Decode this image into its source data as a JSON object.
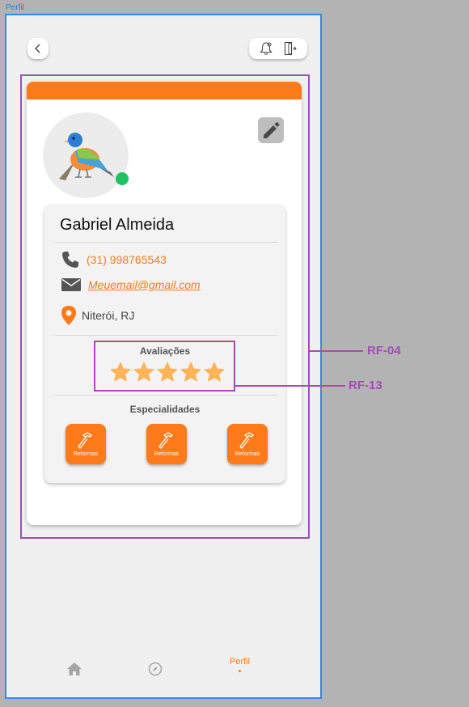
{
  "frame": {
    "label": "Perfil"
  },
  "profile": {
    "name": "Gabriel Almeida",
    "phone": "(31) 998765543",
    "email": "Meuemail@gmail.com",
    "location": "Niterói, RJ"
  },
  "ratings": {
    "title": "Avaliações",
    "stars": 5,
    "max": 5
  },
  "specialties": {
    "title": "Especialidades",
    "items": [
      {
        "label": "Reformas"
      },
      {
        "label": "Reformas"
      },
      {
        "label": "Reformas"
      }
    ]
  },
  "nav": {
    "perfil_label": "Perfil"
  },
  "annotations": {
    "rf04": "RF-04",
    "rf13": "RF-13"
  },
  "colors": {
    "accent": "#ff7a18",
    "status": "#1ec260",
    "annotation": "#a04fb0",
    "frame": "#2f8ee0",
    "star": "#ffb45a"
  }
}
